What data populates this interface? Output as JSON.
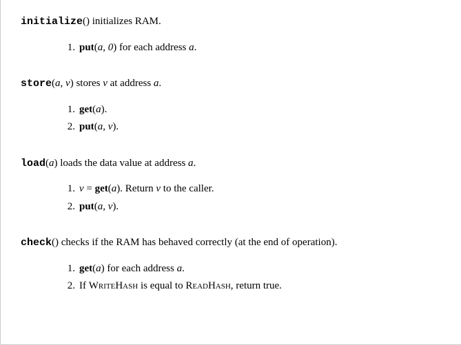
{
  "initialize": {
    "name": "initialize",
    "paren": "()",
    "desc_pre": " initializes RAM.",
    "steps": [
      {
        "num": "1.",
        "pre": "put",
        "args": "a, 0",
        "post": " for each address ",
        "tail_it": "a",
        "tail": "."
      }
    ]
  },
  "store": {
    "name": "store",
    "args": "a, v",
    "desc_pre": " stores ",
    "desc_v": "v",
    "desc_mid": " at address ",
    "desc_a": "a",
    "desc_end": ".",
    "steps": [
      {
        "num": "1.",
        "pre": "get",
        "args": "a",
        "post": "."
      },
      {
        "num": "2.",
        "pre": "put",
        "args": "a, v",
        "post": "."
      }
    ]
  },
  "load": {
    "name": "load",
    "args": "a",
    "desc_pre": " loads the data value at address ",
    "desc_a": "a",
    "desc_end": ".",
    "steps": [
      {
        "num": "1.",
        "lhs_it": "v",
        "eq": " = ",
        "pre": "get",
        "args": "a",
        "post": ". Return ",
        "post_it": "v",
        "post2": " to the caller."
      },
      {
        "num": "2.",
        "pre": "put",
        "args": "a, v",
        "post": "."
      }
    ]
  },
  "check": {
    "name": "check",
    "paren": "()",
    "desc_pre": " checks if the RAM has behaved correctly (at the end of operation).",
    "steps": [
      {
        "num": "1.",
        "pre": "get",
        "args": "a",
        "post": " for each address ",
        "tail_it": "a",
        "tail": "."
      },
      {
        "num": "2.",
        "text_pre": "If ",
        "sc1": "WriteHash",
        "text_mid": " is equal to ",
        "sc2": "ReadHash",
        "text_post": ", return true."
      }
    ]
  }
}
